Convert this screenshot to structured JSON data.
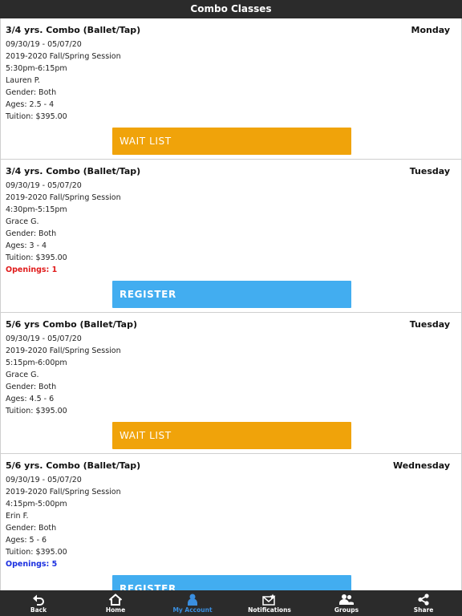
{
  "header": {
    "title": "Combo Classes"
  },
  "classes": [
    {
      "title": "3/4 yrs. Combo (Ballet/Tap)",
      "day": "Monday",
      "dates": "09/30/19 - 05/07/20",
      "session": "2019-2020 Fall/Spring Session",
      "time": "5:30pm-6:15pm",
      "instructor": "Lauren P.",
      "gender": "Gender: Both",
      "ages": "Ages: 2.5 - 4",
      "tuition": "Tuition: $395.00",
      "openings": "",
      "button_label": "WAIT LIST"
    },
    {
      "title": "3/4 yrs. Combo (Ballet/Tap)",
      "day": "Tuesday",
      "dates": "09/30/19 - 05/07/20",
      "session": "2019-2020 Fall/Spring Session",
      "time": "4:30pm-5:15pm",
      "instructor": "Grace G.",
      "gender": "Gender: Both",
      "ages": "Ages: 3 - 4",
      "tuition": "Tuition: $395.00",
      "openings": "Openings: 1",
      "button_label": "REGISTER"
    },
    {
      "title": "5/6 yrs Combo (Ballet/Tap)",
      "day": "Tuesday",
      "dates": "09/30/19 - 05/07/20",
      "session": "2019-2020 Fall/Spring Session",
      "time": "5:15pm-6:00pm",
      "instructor": "Grace G.",
      "gender": "Gender: Both",
      "ages": "Ages: 4.5 - 6",
      "tuition": "Tuition: $395.00",
      "openings": "",
      "button_label": "WAIT LIST"
    },
    {
      "title": "5/6 yrs. Combo (Ballet/Tap)",
      "day": "Wednesday",
      "dates": "09/30/19 - 05/07/20",
      "session": "2019-2020 Fall/Spring Session",
      "time": "4:15pm-5:00pm",
      "instructor": "Erin F.",
      "gender": "Gender: Both",
      "ages": "Ages: 5 - 6",
      "tuition": "Tuition: $395.00",
      "openings": "Openings: 5",
      "button_label": "REGISTER"
    }
  ],
  "colors": {
    "waitlist": "#f0a30a",
    "register": "#42adf0",
    "openings_low": "#e01b1b",
    "openings_ok": "#1b2fe0",
    "active_tab": "#3a8fe0"
  },
  "tabbar": {
    "back": {
      "label": "Back",
      "icon": "back-arrow-icon"
    },
    "home": {
      "label": "Home",
      "icon": "home-icon"
    },
    "account": {
      "label": "My Account",
      "icon": "person-icon"
    },
    "notifications": {
      "label": "Notifications",
      "icon": "envelope-icon"
    },
    "groups": {
      "label": "Groups",
      "icon": "group-icon"
    },
    "share": {
      "label": "Share",
      "icon": "share-icon"
    }
  }
}
